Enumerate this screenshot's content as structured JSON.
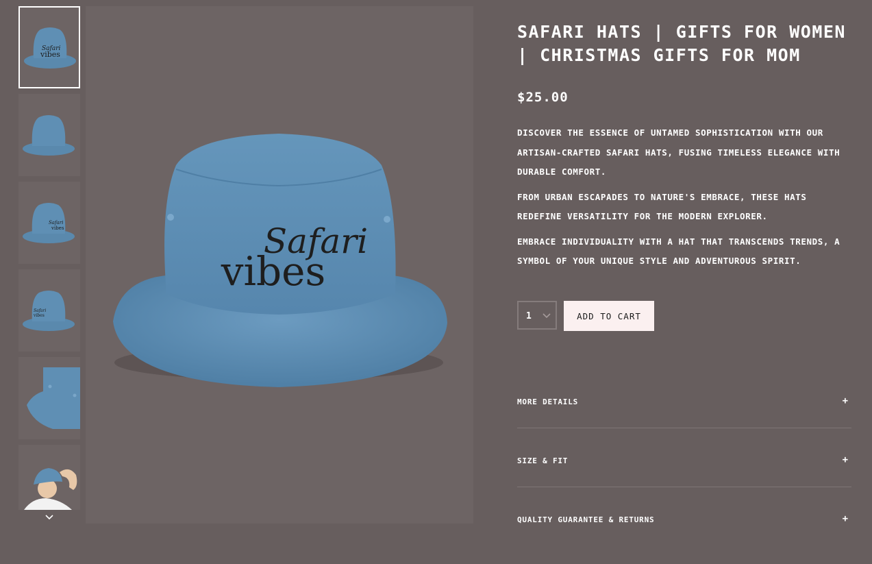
{
  "product": {
    "title": "Safari Hats | Gifts for Women | Christmas Gifts for Mom",
    "price": "$25.00",
    "image_text_line1": "Safari",
    "image_text_line2": "vibes",
    "description": [
      "Discover the essence of untamed sophistication with our artisan-crafted Safari Hats, fusing timeless elegance with durable comfort.",
      "From urban escapades to nature's embrace, these hats redefine versatility for the modern explorer.",
      "Embrace individuality with a hat that transcends trends, a symbol of your unique style and adventurous spirit."
    ]
  },
  "purchase": {
    "quantity": "1",
    "add_to_cart_label": "ADD TO CART"
  },
  "accordion": [
    {
      "label": "More details",
      "icon": "+"
    },
    {
      "label": "Size & Fit",
      "icon": "+"
    },
    {
      "label": "Quality Guarantee & Returns",
      "icon": "+"
    }
  ],
  "thumbnails": [
    {
      "icon": "hat-front-logo-thumbnail"
    },
    {
      "icon": "hat-front-plain-thumbnail"
    },
    {
      "icon": "hat-side-logo-thumbnail"
    },
    {
      "icon": "hat-angle-logo-thumbnail"
    },
    {
      "icon": "hat-closeup-thumbnail"
    },
    {
      "icon": "model-wearing-hat-thumbnail"
    }
  ],
  "colors": {
    "background": "#675e5e",
    "image_panel": "#6d6464",
    "hat_denim": "#5f8fb4",
    "button_bg": "#fbf0f0",
    "text": "#ffffff"
  }
}
